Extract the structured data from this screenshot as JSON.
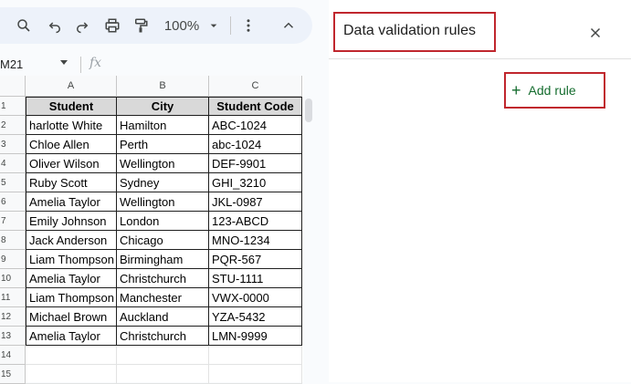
{
  "toolbar": {
    "zoom": "100%",
    "icons": [
      "search-icon",
      "undo-icon",
      "redo-icon",
      "print-icon",
      "paint-format-icon",
      "chevron-down-icon",
      "more-vert-icon",
      "chevron-up-icon"
    ]
  },
  "formula_bar": {
    "name_box": "M21",
    "fx_label": "fx"
  },
  "sheet": {
    "columns": [
      "A",
      "B",
      "C"
    ],
    "row_numbers": [
      "1",
      "2",
      "3",
      "4",
      "5",
      "6",
      "7",
      "8",
      "9",
      "10",
      "11",
      "12",
      "13",
      "14",
      "15"
    ],
    "headers": [
      "Student",
      "City",
      "Student Code"
    ],
    "rows": [
      [
        "harlotte White",
        "Hamilton",
        "ABC-1024"
      ],
      [
        "Chloe Allen",
        "Perth",
        "abc-1024"
      ],
      [
        "Oliver Wilson",
        "Wellington",
        "DEF-9901"
      ],
      [
        "Ruby Scott",
        "Sydney",
        "GHI_3210"
      ],
      [
        "Amelia Taylor",
        "Wellington",
        "JKL-0987"
      ],
      [
        "Emily Johnson",
        "London",
        "123-ABCD"
      ],
      [
        "Jack Anderson",
        "Chicago",
        "MNO-1234"
      ],
      [
        "Liam Thompson",
        "Birmingham",
        "PQR-567"
      ],
      [
        "Amelia Taylor",
        "Christchurch",
        "STU-1111"
      ],
      [
        "Liam Thompson",
        "Manchester",
        "VWX-0000"
      ],
      [
        "Michael Brown",
        "Auckland",
        "YZA-5432"
      ],
      [
        "Amelia Taylor",
        "Christchurch",
        "LMN-9999"
      ]
    ],
    "header_fill": "#d9d9d9"
  },
  "panel": {
    "title": "Data validation rules",
    "add_rule_label": "Add rule",
    "accent": "#146c2e",
    "highlight": "#c0262d"
  }
}
